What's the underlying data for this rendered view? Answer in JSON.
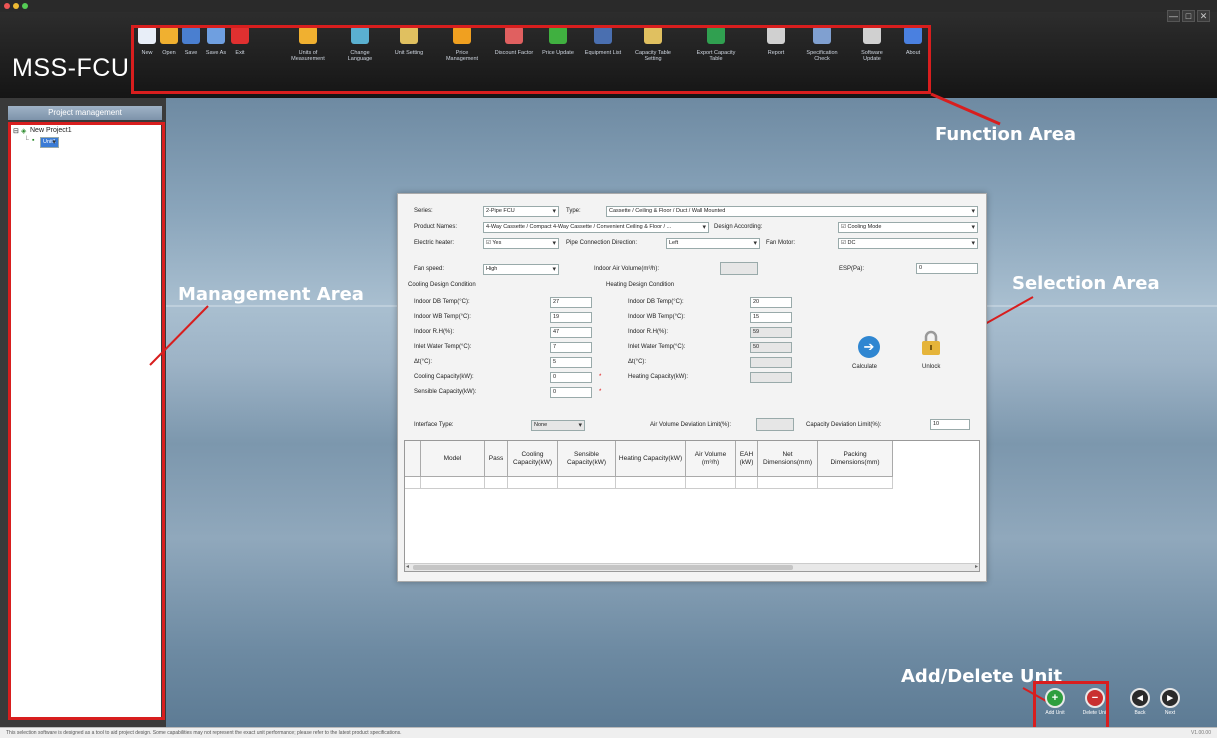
{
  "app": {
    "title": "MSS-FCU"
  },
  "window_controls": [
    "—",
    "□",
    "✕"
  ],
  "toolbar": {
    "items": [
      {
        "label": "New",
        "icon": "new-file-icon",
        "color": "#e8eef8"
      },
      {
        "label": "Open",
        "icon": "open-folder-icon",
        "color": "#f0b030"
      },
      {
        "label": "Save",
        "icon": "save-icon",
        "color": "#4a7fd0"
      },
      {
        "label": "Save As",
        "icon": "save-as-icon",
        "color": "#6f9fe0"
      },
      {
        "label": "Exit",
        "icon": "exit-icon",
        "color": "#e03030"
      },
      {
        "label": "Units of Measurement",
        "icon": "pencil-icon",
        "color": "#f0b030"
      },
      {
        "label": "Change Language",
        "icon": "globe-icon",
        "color": "#5ab0d0"
      },
      {
        "label": "Unit Setting",
        "icon": "gear-icon",
        "color": "#e0c060"
      },
      {
        "label": "Price Management",
        "icon": "price-icon",
        "color": "#f0a020"
      },
      {
        "label": "Discount Factor",
        "icon": "discount-icon",
        "color": "#e06060"
      },
      {
        "label": "Price Update",
        "icon": "refresh-icon",
        "color": "#40b040"
      },
      {
        "label": "Equipment List",
        "icon": "list-icon",
        "color": "#4a6fb0"
      },
      {
        "label": "Capacity Table Setting",
        "icon": "gear-icon",
        "color": "#e0c060"
      },
      {
        "label": "Export Capacity Table",
        "icon": "excel-icon",
        "color": "#30a050"
      },
      {
        "label": "Report",
        "icon": "printer-icon",
        "color": "#d0d0d0"
      },
      {
        "label": "Specification Check",
        "icon": "magnifier-icon",
        "color": "#80a0d0"
      },
      {
        "label": "Software Update",
        "icon": "update-icon",
        "color": "#d0d0d0"
      },
      {
        "label": "About",
        "icon": "help-icon",
        "color": "#4a80e0"
      }
    ]
  },
  "project_panel": {
    "header": "Project management",
    "tree": [
      {
        "label": "New Project1",
        "level": 0
      },
      {
        "label": "Unit1",
        "level": 1,
        "selected": true
      }
    ]
  },
  "annotations": {
    "function_area": "Function Area",
    "management_area": "Management Area",
    "selection_area": "Selection Area",
    "add_delete_unit": "Add/Delete Unit"
  },
  "selection": {
    "series_label": "Series:",
    "series_value": "2-Pipe FCU",
    "type_label": "Type:",
    "type_value": "Cassette / Ceiling & Floor / Duct / Wall Mounted",
    "product_names_label": "Product Names:",
    "product_names_value": "4-Way Cassette / Compact 4-Way Cassette / Convenient Ceiling & Floor / ...",
    "design_according_label": "Design According:",
    "design_according_value": "Cooling Mode",
    "electric_heater_label": "Electric heater:",
    "electric_heater_value": "Yes",
    "pipe_connection_label": "Pipe Connection Direction:",
    "pipe_connection_value": "Left",
    "fan_motor_label": "Fan Motor:",
    "fan_motor_value": "DC",
    "fan_speed_label": "Fan speed:",
    "fan_speed_value": "High",
    "indoor_air_volume_label": "Indoor Air Volume(m³/h):",
    "esp_label": "ESP(Pa):",
    "esp_value": "0",
    "cooling_title": "Cooling Design Condition",
    "heating_title": "Heating Design Condition",
    "cooling_rows": [
      {
        "label": "Indoor DB Temp(°C):",
        "value": "27"
      },
      {
        "label": "Indoor WB Temp(°C):",
        "value": "19"
      },
      {
        "label": "Indoor R.H(%):",
        "value": "47"
      },
      {
        "label": "Inlet Water Temp(°C):",
        "value": "7"
      },
      {
        "label": "Δt(°C):",
        "value": "5"
      },
      {
        "label": "Cooling Capacity(kW):",
        "value": "0"
      },
      {
        "label": "Sensible Capacity(kW):",
        "value": "0"
      }
    ],
    "heating_rows": [
      {
        "label": "Indoor DB Temp(°C):",
        "value": "20"
      },
      {
        "label": "Indoor WB Temp(°C):",
        "value": "15"
      },
      {
        "label": "Indoor R.H(%):",
        "value": "59"
      },
      {
        "label": "Inlet Water Temp(°C):",
        "value": "50"
      },
      {
        "label": "Δt(°C):",
        "value": ""
      },
      {
        "label": "Heating Capacity(kW):",
        "value": ""
      }
    ],
    "calculate_label": "Calculate",
    "unlock_label": "Unlock",
    "interface_type_label": "Interface Type:",
    "interface_type_value": "None",
    "air_volume_dev_label": "Air Volume Deviation Limit(%):",
    "capacity_dev_label": "Capacity Deviation Limit(%):",
    "capacity_dev_value": "10"
  },
  "results_table": {
    "columns": [
      "Model",
      "Pass",
      "Cooling Capacity(kW)",
      "Sensible Capacity(kW)",
      "Heating Capacity(kW)",
      "Air Volume (m³/h)",
      "EAH (kW)",
      "Net Dimensions(mm)",
      "Packing Dimensions(mm)"
    ]
  },
  "bottom_buttons": [
    {
      "label": "Add Unit",
      "icon": "add-icon",
      "color": "#2e9e3e"
    },
    {
      "label": "Delete Unit",
      "icon": "delete-icon",
      "color": "#c93030"
    },
    {
      "label": "Back",
      "icon": "back-icon",
      "color": "#2a2a2a"
    },
    {
      "label": "Next",
      "icon": "next-icon",
      "color": "#2a2a2a"
    }
  ],
  "status": {
    "message": "This selection software is designed as a tool to aid project design. Some capabilities may not represent the exact unit performance; please refer to the latest product specifications.",
    "version": "V1.00.00"
  }
}
